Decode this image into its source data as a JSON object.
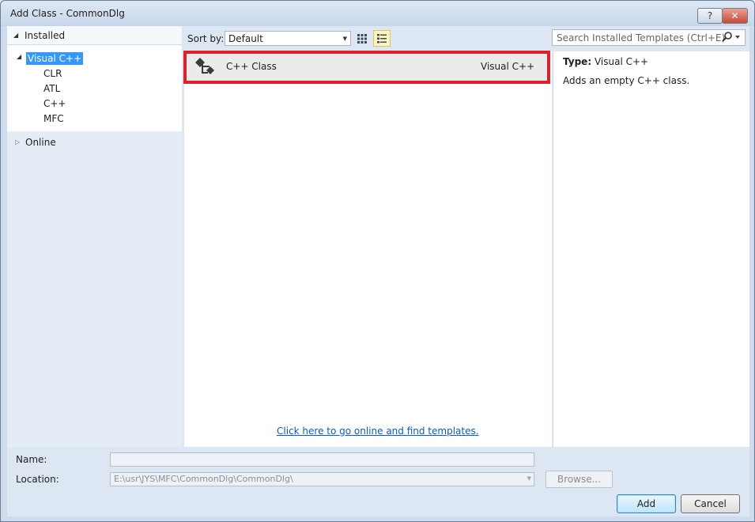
{
  "window": {
    "title": "Add Class - CommonDlg",
    "help_label": "?",
    "close_label": "✕"
  },
  "tree": {
    "installed_label": "Installed",
    "selected_label": "Visual C++",
    "children": [
      "CLR",
      "ATL",
      "C++",
      "MFC"
    ],
    "online_label": "Online"
  },
  "sort": {
    "label": "Sort by:",
    "value": "Default"
  },
  "search": {
    "placeholder": "Search Installed Templates (Ctrl+E)"
  },
  "templates": [
    {
      "name": "C++ Class",
      "language": "Visual C++"
    }
  ],
  "online_link": "Click here to go online and find templates.",
  "details": {
    "type_label": "Type:",
    "type_value": "Visual C++",
    "description": "Adds an empty C++ class."
  },
  "form": {
    "name_label": "Name:",
    "name_value": "",
    "location_label": "Location:",
    "location_value": "E:\\usr\\JYS\\MFC\\CommonDlg\\CommonDlg\\",
    "browse_label": "Browse...",
    "add_label": "Add",
    "cancel_label": "Cancel"
  },
  "colors": {
    "selection": "#3399ff",
    "highlight_box": "#e0202a",
    "link": "#0a5bc4"
  }
}
